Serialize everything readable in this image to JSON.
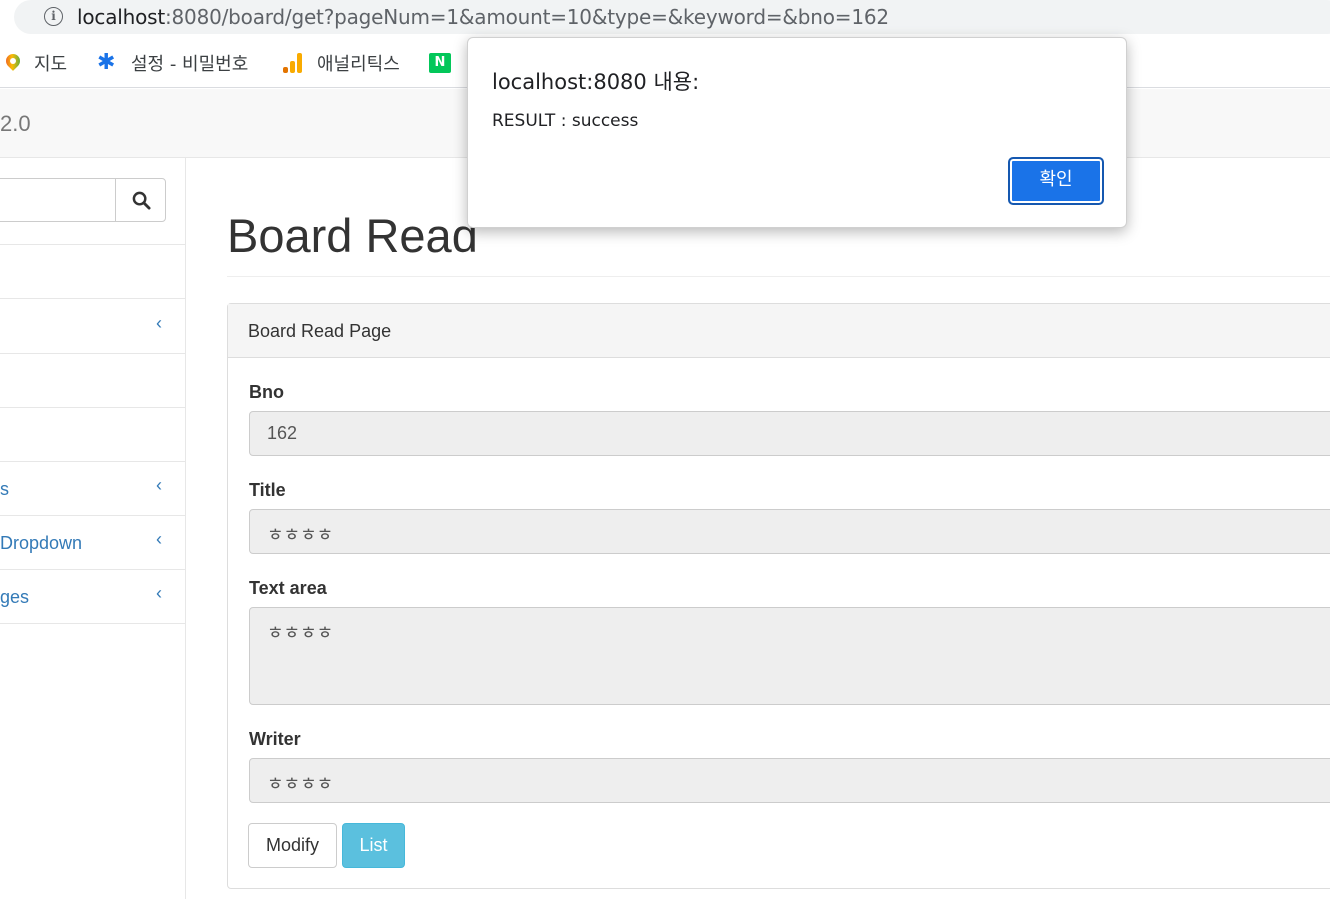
{
  "browser": {
    "url_host": "localhost",
    "url_rest": ":8080/board/get?pageNum=1&amount=10&type=&keyword=&bno=162",
    "bookmarks": [
      {
        "label": "지도",
        "icon": "maps-pin-icon"
      },
      {
        "label": "설정 - 비밀번호",
        "icon": "gear-icon"
      },
      {
        "label": "애널리틱스",
        "icon": "analytics-bars-icon"
      },
      {
        "label": "N",
        "icon": "naver-icon"
      }
    ]
  },
  "navbar": {
    "brand": "2.0"
  },
  "sidebar": {
    "items": [
      {
        "label": "",
        "has_chevron": false
      },
      {
        "label": "",
        "has_chevron": true
      },
      {
        "label": "",
        "has_chevron": false
      },
      {
        "label": "",
        "has_chevron": false
      },
      {
        "label": "s",
        "has_chevron": true
      },
      {
        "label": "Dropdown",
        "has_chevron": true
      },
      {
        "label": "ges",
        "has_chevron": true
      }
    ],
    "chevron": "‹"
  },
  "page": {
    "title": "Board Read",
    "panel_heading": "Board Read Page",
    "fields": {
      "bno_label": "Bno",
      "bno_value": "162",
      "title_label": "Title",
      "title_value": "ㅎㅎㅎㅎ",
      "content_label": "Text area",
      "content_value": "ㅎㅎㅎㅎ",
      "writer_label": "Writer",
      "writer_value": "ㅎㅎㅎㅎ"
    },
    "buttons": {
      "modify": "Modify",
      "list": "List"
    }
  },
  "dialog": {
    "title": "localhost:8080 내용:",
    "message": "RESULT : success",
    "ok_label": "확인"
  },
  "colors": {
    "link": "#337ab7",
    "info_button": "#5bc0de",
    "dialog_button": "#1a73e8"
  }
}
